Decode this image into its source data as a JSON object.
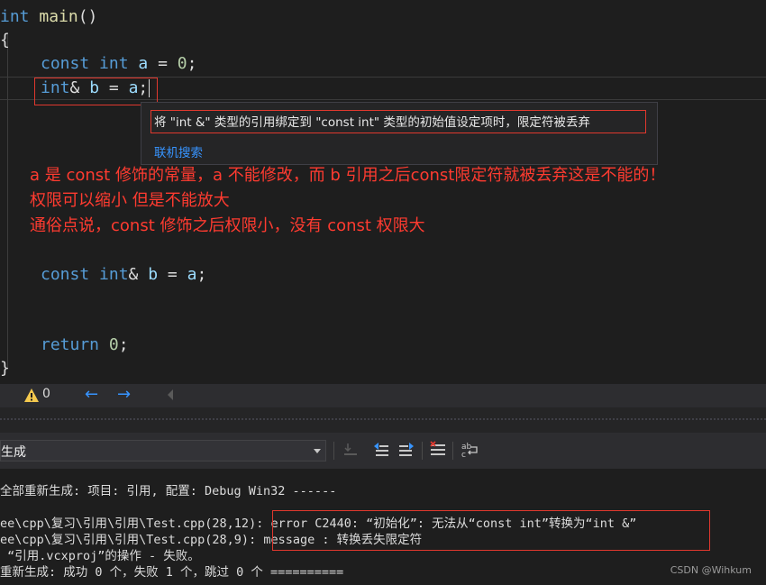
{
  "editor": {
    "lines": {
      "l1": {
        "kw": "int",
        "fn": "main",
        "rest": "()"
      },
      "l2": "{",
      "l3": {
        "kw1": "const",
        "kw2": "int",
        "var": "a",
        "op": " = ",
        "num": "0",
        "end": ";"
      },
      "l4": {
        "kw": "int",
        "amp": "&",
        "var1": "b",
        "op": " = ",
        "var2": "a",
        "end": ";"
      },
      "l5": {
        "kw1": "const",
        "kw2": "int",
        "amp": "&",
        "var1": "b",
        "op": " = ",
        "var2": "a",
        "end": ";"
      },
      "l6": {
        "kw": "return",
        "num": "0",
        "end": ";"
      },
      "l7": "}"
    },
    "tooltip": {
      "message": "将 \"int &\" 类型的引用绑定到 \"const int\" 类型的初始值设定项时，限定符被丢弃",
      "link": "联机搜索"
    },
    "notes": [
      "a 是 const 修饰的常量，a 不能修改，而 b 引用之后const限定符就被丢弃这是不能的！",
      "权限可以缩小 但是不能放大",
      "通俗点说，const 修饰之后权限小，没有 const 权限大"
    ]
  },
  "statusbar": {
    "warning_count": "0",
    "back_arrow": "←",
    "forward_arrow": "→"
  },
  "output": {
    "source_selected": "生成",
    "lines": [
      "全部重新生成: 项目: 引用, 配置: Debug Win32 ------",
      "",
      "ee\\cpp\\复习\\引用\\引用\\Test.cpp(28,12): error C2440: “初始化”: 无法从“const int”转换为“int &”",
      "ee\\cpp\\复习\\引用\\引用\\Test.cpp(28,9): message : 转换丢失限定符",
      " “引用.vcxproj”的操作 - 失败。",
      "重新生成: 成功 0 个，失败 1 个，跳过 0 个 =========="
    ]
  },
  "watermark": "CSDN @Wihkum",
  "colors": {
    "accent_red": "#e0382e",
    "link_blue": "#3794ff",
    "keyword": "#569cd6"
  }
}
